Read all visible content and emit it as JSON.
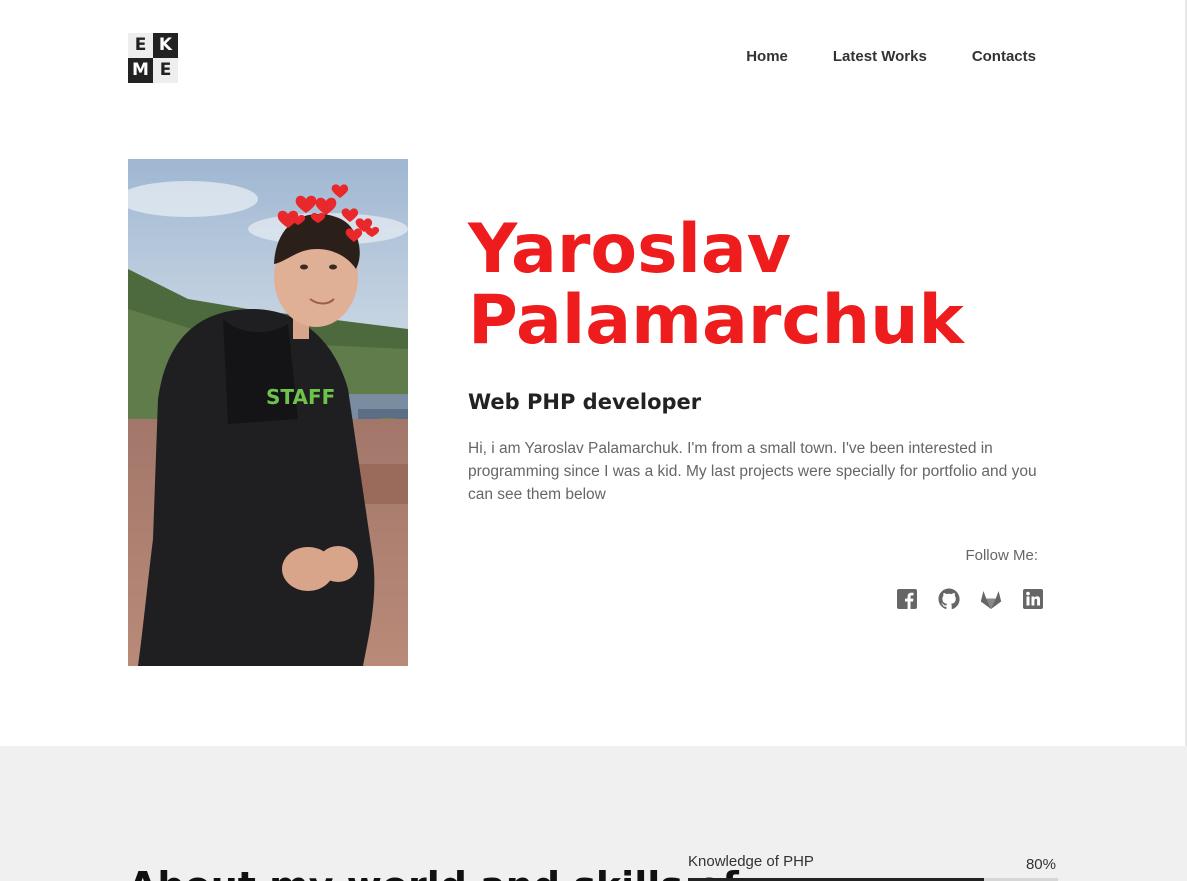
{
  "logo": {
    "letters": [
      "E",
      "K",
      "M",
      "E"
    ]
  },
  "nav": {
    "items": [
      {
        "label": "Home"
      },
      {
        "label": "Latest Works"
      },
      {
        "label": "Contacts"
      }
    ]
  },
  "hero": {
    "name_line1": "Yaroslav",
    "name_line2": "Palamarchuk",
    "role": "Web PHP developer",
    "bio": "Hi, i am Yaroslav Palamarchuk. I'm from a small town. I've been interested in programming since I was a kid. My last projects were specially for portfolio and you can see them below",
    "shirt_text": "STAFF"
  },
  "follow": {
    "label": "Follow Me:",
    "icons": [
      "facebook-icon",
      "github-icon",
      "gitlab-icon",
      "linkedin-icon"
    ]
  },
  "skills": {
    "heading": "About my world and skills of",
    "items": [
      {
        "label": "Knowledge of PHP",
        "percent_text": "80%",
        "percent": 80
      }
    ]
  },
  "colors": {
    "accent": "#ee1c1c",
    "text": "#222222",
    "muted": "#666666",
    "section_bg": "#f0f0f0"
  }
}
